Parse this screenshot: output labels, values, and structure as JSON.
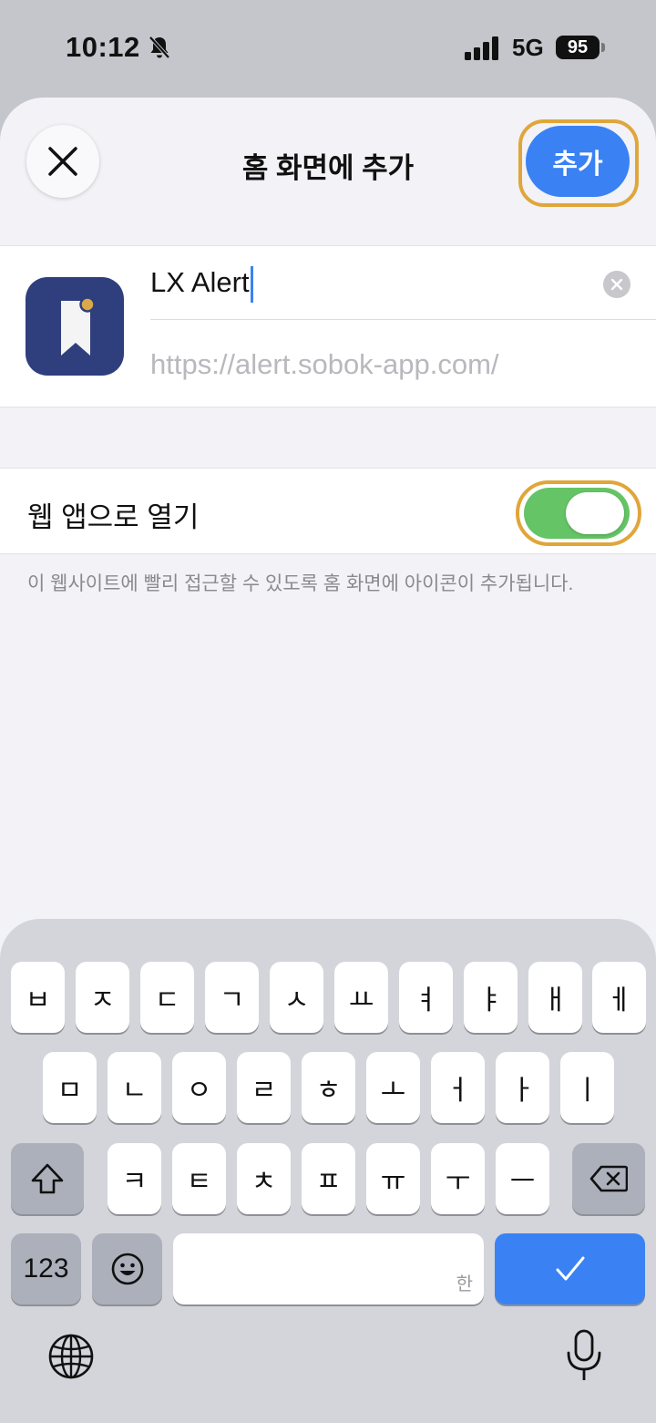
{
  "status_bar": {
    "time": "10:12",
    "network": "5G",
    "battery": "95"
  },
  "header": {
    "title": "홈 화면에 추가",
    "add_label": "추가"
  },
  "app": {
    "name_value": "LX Alert",
    "url": "https://alert.sobok-app.com/"
  },
  "web_app_toggle": {
    "label": "웹 앱으로 열기",
    "enabled": true
  },
  "footnote": "이 웹사이트에 빨리 접근할 수 있도록 홈 화면에 아이콘이 추가됩니다.",
  "keyboard": {
    "row1": [
      "ㅂ",
      "ㅈ",
      "ㄷ",
      "ㄱ",
      "ㅅ",
      "ㅛ",
      "ㅕ",
      "ㅑ",
      "ㅐ",
      "ㅔ"
    ],
    "row2": [
      "ㅁ",
      "ㄴ",
      "ㅇ",
      "ㄹ",
      "ㅎ",
      "ㅗ",
      "ㅓ",
      "ㅏ",
      "ㅣ"
    ],
    "row3": [
      "ㅋ",
      "ㅌ",
      "ㅊ",
      "ㅍ",
      "ㅠ",
      "ㅜ",
      "ㅡ"
    ],
    "numbers_label": "123",
    "space_hint": "한",
    "icons": {
      "shift": "shift-icon",
      "delete": "delete-icon",
      "emoji": "emoji-icon",
      "done": "checkmark-icon",
      "globe": "globe-icon",
      "mic": "microphone-icon"
    }
  },
  "colors": {
    "accent": "#3a82f3",
    "toggle_on": "#65c466",
    "highlight_ring": "#e0a63a",
    "app_icon_bg": "#2f3e7d"
  }
}
